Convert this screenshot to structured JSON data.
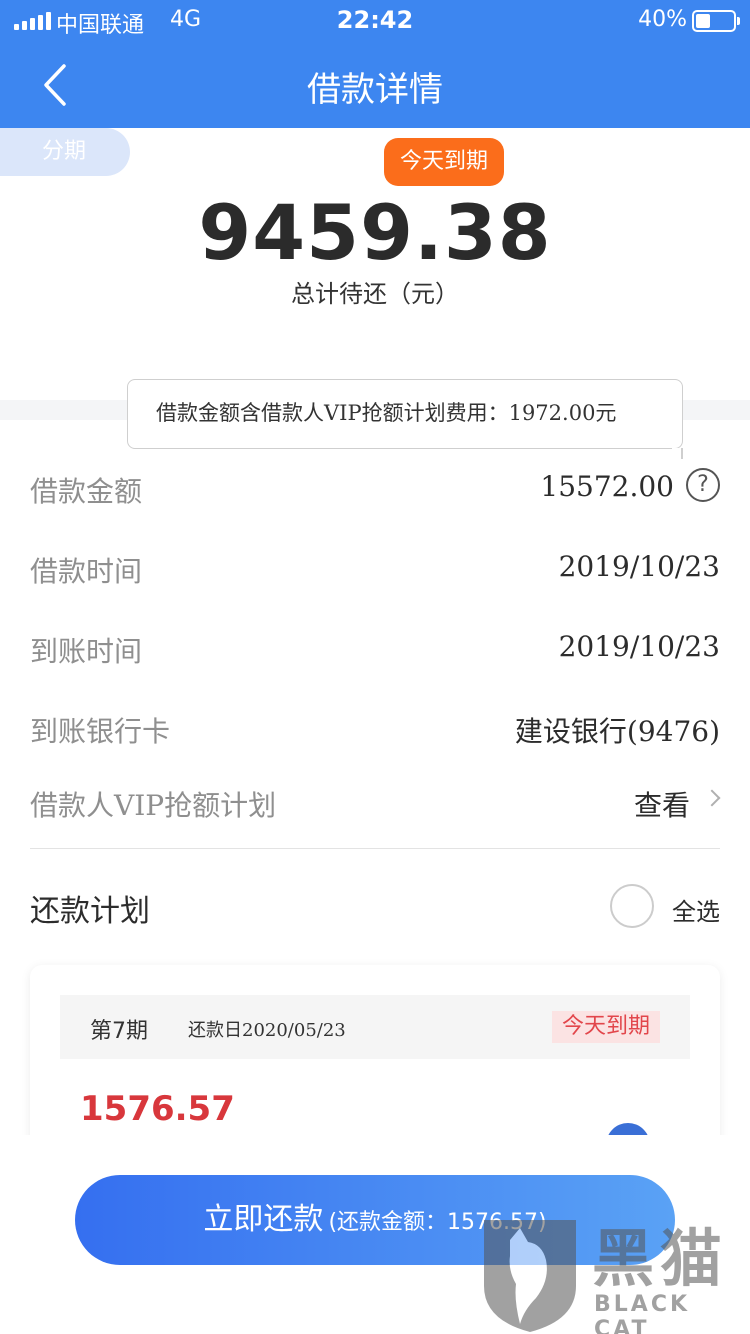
{
  "status_bar": {
    "carrier": "中国联通",
    "network": "4G",
    "time": "22:42",
    "battery": "40%",
    "battery_level": 0.4
  },
  "nav": {
    "title": "借款详情",
    "back_icon": "chevron-left-icon"
  },
  "summary": {
    "installment_tag": "分期",
    "due_badge": "今天到期",
    "total_amount": "9459.38",
    "total_label": "总计待还（元）"
  },
  "tooltip": {
    "text": "借款金额含借款人VIP抢额计划费用：1972.00元"
  },
  "details": {
    "loan_amount_label": "借款金额",
    "loan_amount_value": "15572.00",
    "help_icon": "question-circle-icon",
    "loan_time_label": "借款时间",
    "loan_time_value": "2019/10/23",
    "arrival_time_label": "到账时间",
    "arrival_time_value": "2019/10/23",
    "bank_card_label": "到账银行卡",
    "bank_card_value": "建设银行(9476)",
    "vip_plan_label": "借款人VIP抢额计划",
    "vip_plan_link": "查看"
  },
  "plan": {
    "title": "还款计划",
    "select_all": "全选",
    "items": [
      {
        "period": "第7期",
        "due_date": "还款日2020/05/23",
        "due_tag": "今天到期",
        "amount": "1576.57"
      }
    ]
  },
  "footer": {
    "pay_label": "立即还款",
    "pay_sub": "(还款金额：1576.57)"
  },
  "watermark": {
    "cn": "黑猫",
    "en": "BLACK CAT"
  },
  "colors": {
    "brand_blue": "#3d86f0",
    "due_orange": "#fb6d1b",
    "amount_red": "#d8373c"
  }
}
